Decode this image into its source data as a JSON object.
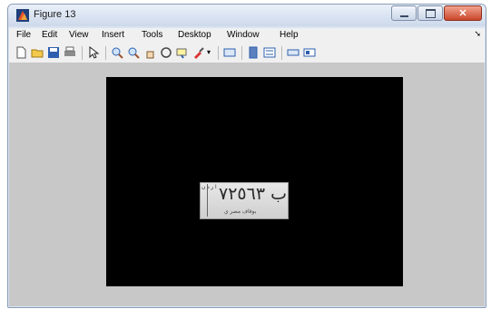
{
  "window": {
    "title": "Figure 13",
    "minimize_icon": "minimize-icon",
    "maximize_icon": "maximize-icon",
    "close_icon": "close-icon"
  },
  "menubar": {
    "items": [
      "File",
      "Edit",
      "View",
      "Insert",
      "Tools",
      "Desktop",
      "Window",
      "Help"
    ],
    "overflow_icon": "chevron-right-icon"
  },
  "toolbar": {
    "buttons": [
      "new-figure-icon",
      "open-file-icon",
      "save-icon",
      "print-icon",
      "edit-plot-arrow-icon",
      "zoom-in-icon",
      "zoom-out-icon",
      "pan-icon",
      "rotate-3d-icon",
      "data-cursor-icon",
      "brush-icon",
      "link-plot-icon",
      "colorbar-icon",
      "legend-icon",
      "hide-plot-tools-icon",
      "show-plot-tools-icon"
    ]
  },
  "figure": {
    "plate_number": "٧٢٥٦٣",
    "plate_letter": "ب",
    "plate_left_text": "ا ر د ن",
    "plate_bottom_text": "يوقاف  مصر ي",
    "colors": {
      "axes_bg": "#000000",
      "figure_bg": "#c8c8c8"
    }
  }
}
